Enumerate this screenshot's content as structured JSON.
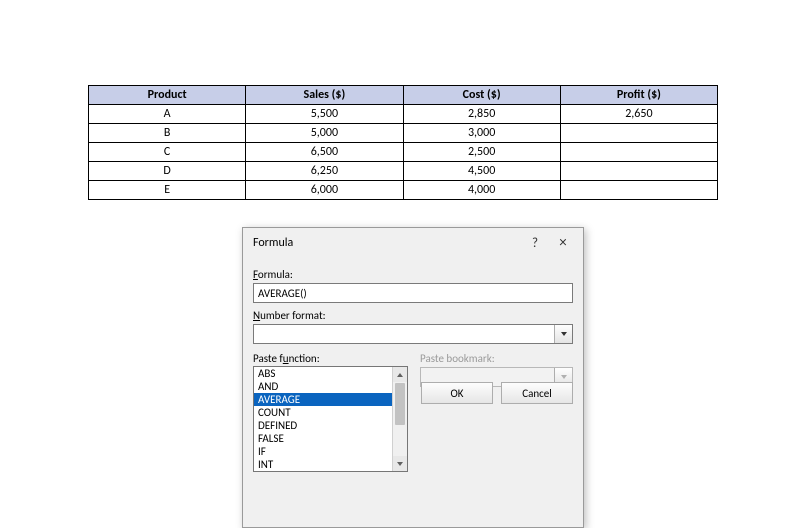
{
  "table": {
    "headers": [
      "Product",
      "Sales ($)",
      "Cost ($)",
      "Profit ($)"
    ],
    "rows": [
      [
        "A",
        "5,500",
        "2,850",
        "2,650"
      ],
      [
        "B",
        "5,000",
        "3,000",
        ""
      ],
      [
        "C",
        "6,500",
        "2,500",
        ""
      ],
      [
        "D",
        "6,250",
        "4,500",
        ""
      ],
      [
        "E",
        "6,000",
        "4,000",
        ""
      ]
    ]
  },
  "dialog": {
    "title": "Formula",
    "help_symbol": "?",
    "close_symbol": "×",
    "formula_label_pre": "F",
    "formula_label_rest": "ormula:",
    "formula_value": "AVERAGE()",
    "numfmt_label_pre": "N",
    "numfmt_label_rest": "umber format:",
    "numfmt_value": "",
    "pastefn_label_pre": "Paste f",
    "pastefn_label_u": "u",
    "pastefn_label_rest": "nction:",
    "pastebm_label": "Paste bookmark:",
    "func_items": [
      "ABS",
      "AND",
      "AVERAGE",
      "COUNT",
      "DEFINED",
      "FALSE",
      "IF",
      "INT"
    ],
    "selected_func_index": 2,
    "ok_label": "OK",
    "cancel_label": "Cancel"
  }
}
